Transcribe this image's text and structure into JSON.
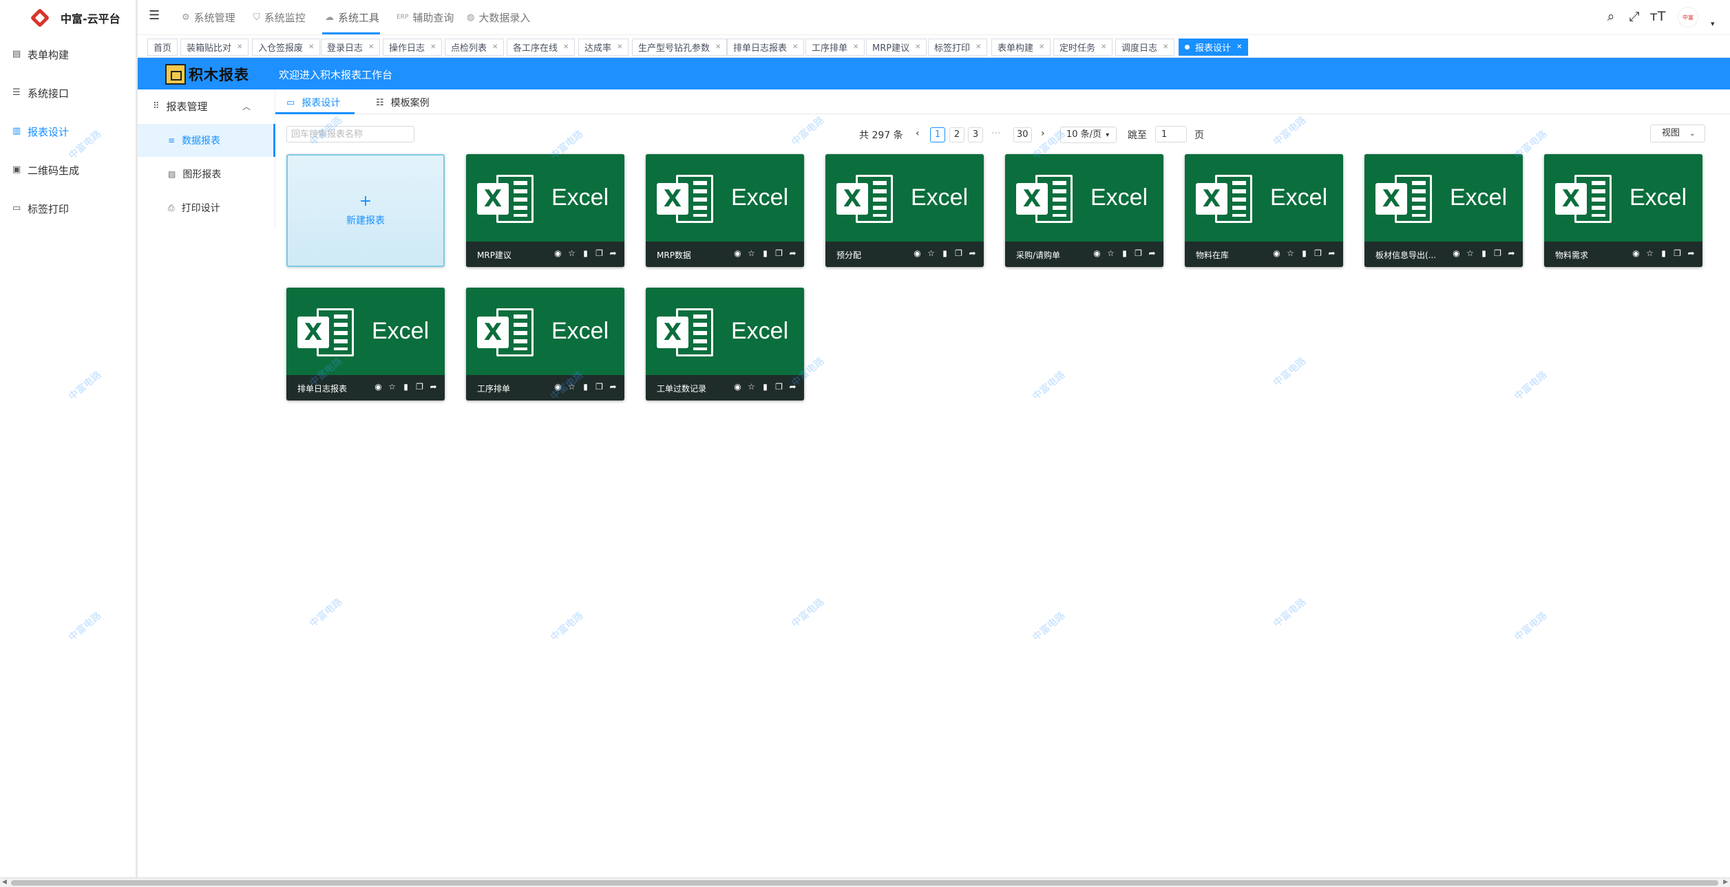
{
  "app": {
    "name": "中富-云平台"
  },
  "sidebar": {
    "items": [
      {
        "label": "表单构建",
        "icon": "form-icon"
      },
      {
        "label": "系统接口",
        "icon": "sliders-icon"
      },
      {
        "label": "报表设计",
        "icon": "report-icon",
        "active": true
      },
      {
        "label": "二维码生成",
        "icon": "qrcode-icon"
      },
      {
        "label": "标签打印",
        "icon": "tag-icon"
      }
    ]
  },
  "topnav": {
    "items": [
      {
        "label": "系统管理",
        "icon": "gear-icon"
      },
      {
        "label": "系统监控",
        "icon": "shield-icon"
      },
      {
        "label": "系统工具",
        "icon": "cloud-icon",
        "active": true
      },
      {
        "label": "辅助查询",
        "icon": "erp-icon",
        "prefix": "ERP"
      },
      {
        "label": "大数据录入",
        "icon": "globe-icon"
      }
    ],
    "avatar_text": "中富"
  },
  "tags": [
    {
      "label": "首页",
      "closable": false
    },
    {
      "label": "装箱贴比对"
    },
    {
      "label": "入仓签报废"
    },
    {
      "label": "登录日志"
    },
    {
      "label": "操作日志"
    },
    {
      "label": "点检列表"
    },
    {
      "label": "各工序在线"
    },
    {
      "label": "达成率"
    },
    {
      "label": "生产型号钻孔参数"
    },
    {
      "label": "排单日志报表"
    },
    {
      "label": "工序排单"
    },
    {
      "label": "MRP建议"
    },
    {
      "label": "标签打印"
    },
    {
      "label": "表单构建"
    },
    {
      "label": "定时任务"
    },
    {
      "label": "调度日志"
    },
    {
      "label": "报表设计",
      "active": true
    }
  ],
  "banner": {
    "logo_text": "积木报表",
    "welcome": "欢迎进入积木报表工作台"
  },
  "submenu": {
    "header": "报表管理",
    "items": [
      {
        "label": "数据报表",
        "active": true
      },
      {
        "label": "图形报表"
      },
      {
        "label": "打印设计"
      }
    ]
  },
  "content_tabs": [
    {
      "label": "报表设计",
      "active": true
    },
    {
      "label": "模板案例"
    }
  ],
  "toolbar": {
    "search_placeholder": "回车搜索报表名称",
    "total": "共 297 条",
    "pages": [
      "1",
      "2",
      "3",
      "30"
    ],
    "ellipsis": "···",
    "page_size": "10 条/页",
    "jump_label": "跳至",
    "jump_value": "1",
    "jump_unit": "页",
    "view_label": "视图"
  },
  "new_report": {
    "plus": "+",
    "label": "新建报表"
  },
  "excel_word": "Excel",
  "excel_letter": "X",
  "cards": [
    {
      "title": "MRP建议"
    },
    {
      "title": "MRP数据"
    },
    {
      "title": "预分配"
    },
    {
      "title": "采购/请购单"
    },
    {
      "title": "物料在库"
    },
    {
      "title": "板材信息导出(..."
    },
    {
      "title": "物料需求"
    },
    {
      "title": "排单日志报表"
    },
    {
      "title": "工序排单"
    },
    {
      "title": "工单过数记录"
    }
  ],
  "watermark": "中富电路",
  "colors": {
    "accent": "#1890ff",
    "excel_green": "#0b6e3d",
    "banner": "#1e90ff"
  }
}
